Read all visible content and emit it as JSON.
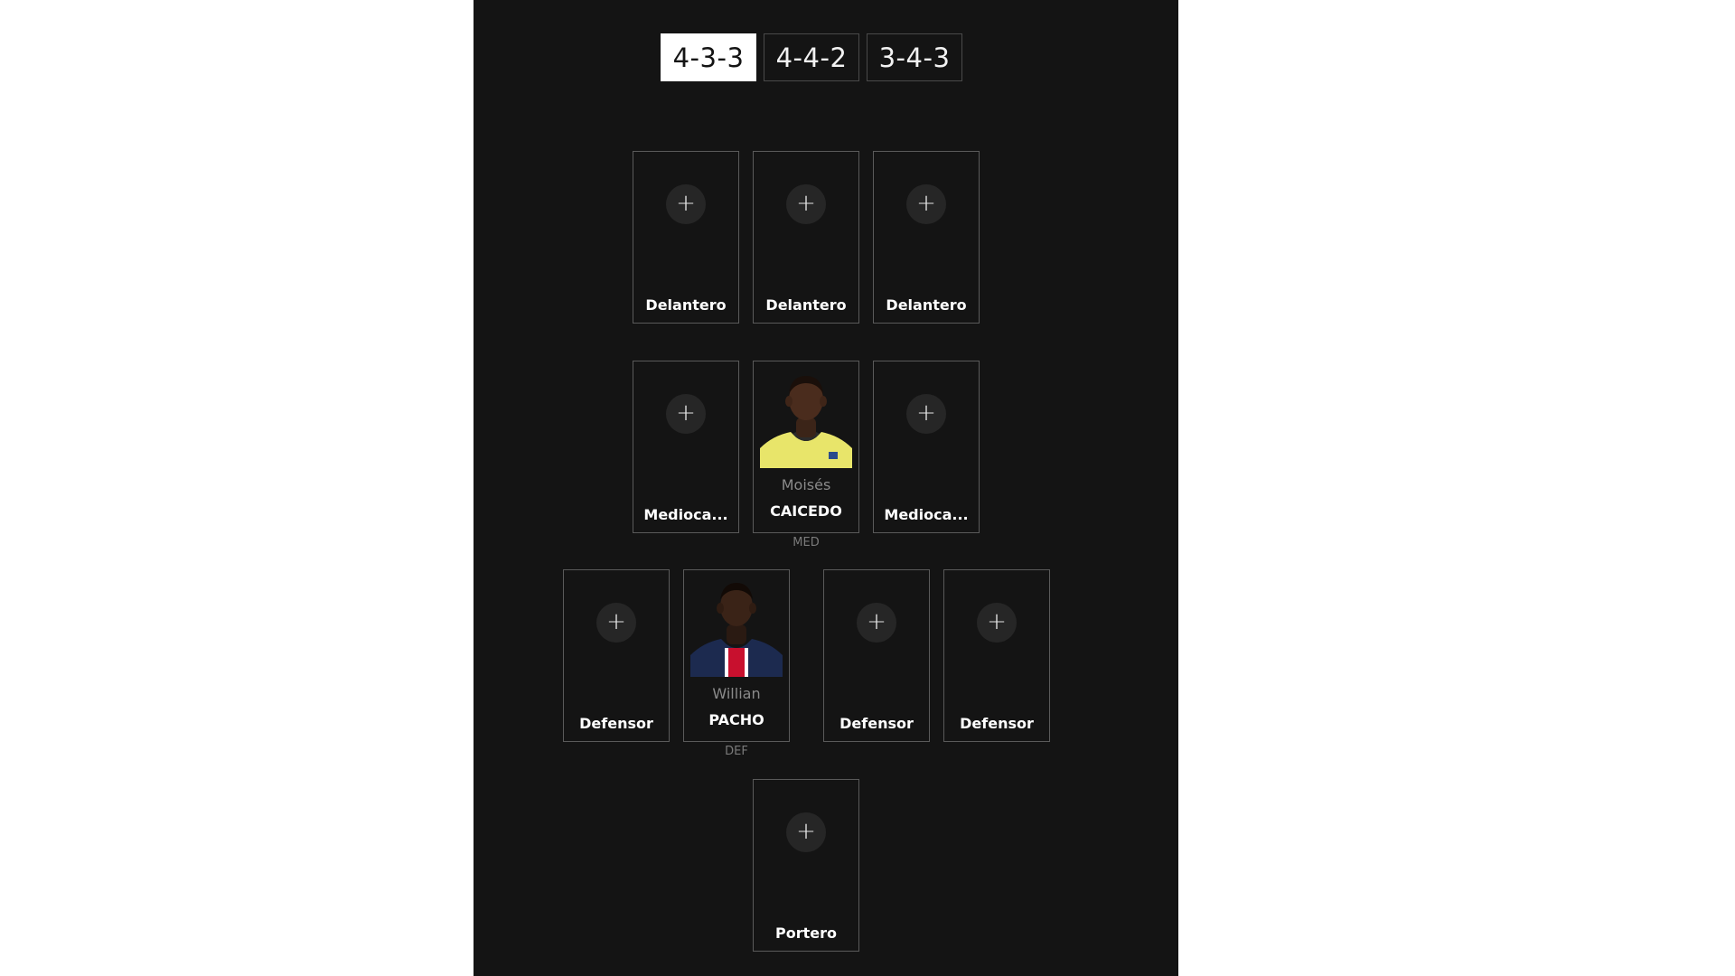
{
  "formations": {
    "tabs": [
      {
        "label": "4-3-3",
        "active": true
      },
      {
        "label": "4-4-2",
        "active": false
      },
      {
        "label": "3-4-3",
        "active": false
      }
    ]
  },
  "forwards": [
    {
      "label": "Delantero"
    },
    {
      "label": "Delantero"
    },
    {
      "label": "Delantero"
    }
  ],
  "midfielders": [
    {
      "label": "Medioca..."
    },
    {
      "first_name": "Moisés",
      "last_name": "CAICEDO",
      "position": "MED"
    },
    {
      "label": "Medioca..."
    }
  ],
  "defenders": [
    {
      "label": "Defensor"
    },
    {
      "first_name": "Willian",
      "last_name": "PACHO",
      "position": "DEF"
    },
    {
      "label": "Defensor"
    },
    {
      "label": "Defensor"
    }
  ],
  "goalkeeper": {
    "label": "Portero"
  },
  "icons": {
    "add": "plus-icon"
  },
  "colors": {
    "background": "#141414",
    "card_border": "#5a5a5a",
    "active_tab": "#ffffff",
    "caicedo_shirt": "#e8e56a",
    "pacho_shirt": "#1c2a4f"
  }
}
